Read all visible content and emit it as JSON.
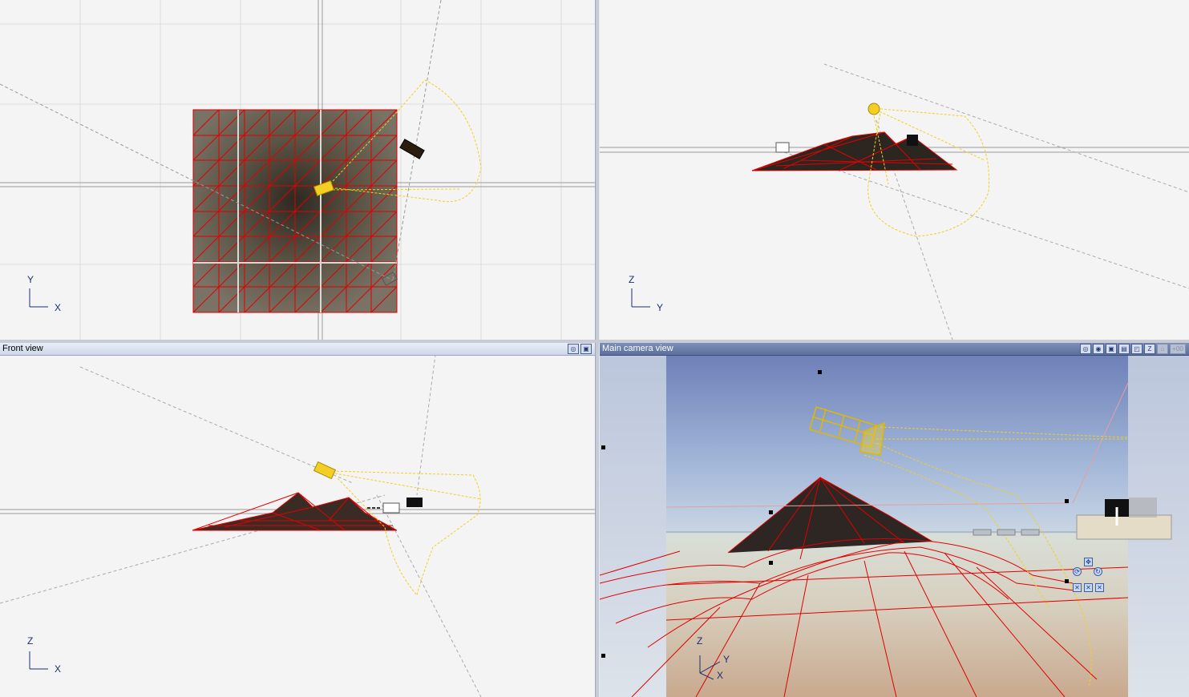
{
  "viewports": {
    "top": {
      "axis_v": "Y",
      "axis_h": "X"
    },
    "right": {
      "axis_v": "Z",
      "axis_h": "Y"
    },
    "front": {
      "title": "Front view",
      "axis_v": "Z",
      "axis_h": "X"
    },
    "camera": {
      "title": "Main camera view",
      "axis_v": "Z",
      "axis_h1": "Y",
      "axis_h2": "X",
      "zoom_label": "+00"
    }
  },
  "icons": {
    "front_toolbar": [
      "view-options-icon",
      "maximize-icon"
    ],
    "camera_toolbar": [
      "view-options-icon",
      "render-icon",
      "maximize-icon",
      "xy-plane-icon",
      "xz-plane-icon",
      "yz-plane-icon",
      "lock-icon",
      "zoom-icon"
    ],
    "camera_nav": [
      "move-icon",
      "rotate-icon",
      "pan-x-icon",
      "pan-y-icon",
      "pan-z-icon"
    ]
  },
  "colors": {
    "wire": "#e00000",
    "light": "#f2cf22",
    "title_active": "#5d709b",
    "title_inactive": "#cdd6ea"
  }
}
